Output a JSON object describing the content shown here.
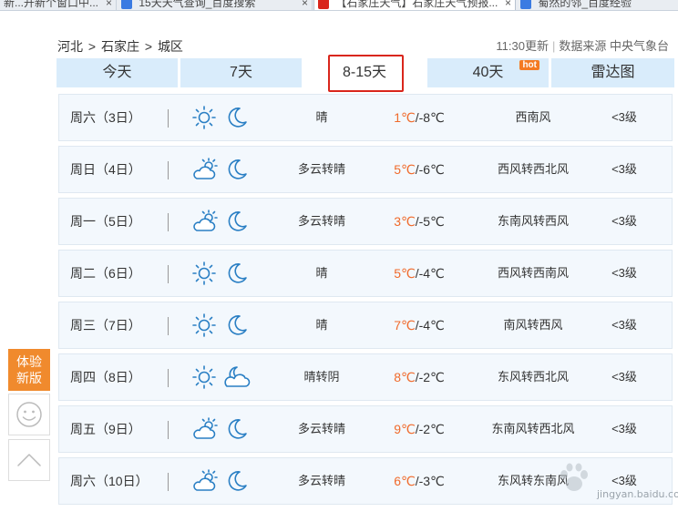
{
  "browser_tabs": [
    {
      "label": "新...开新个窗口中...",
      "favicon_color": "#4a7fd6"
    },
    {
      "label": "15天天气查询_百度搜索",
      "favicon_color": "#3b7be2"
    },
    {
      "label": "【石家庄天气】石家庄天气预报...",
      "favicon_color": "#d9261c"
    },
    {
      "label": "蜀然的邻_百度经验",
      "favicon_color": "#3b7be2"
    }
  ],
  "location": {
    "province": "河北",
    "city": "石家庄",
    "district": "城区",
    "separator": ">"
  },
  "update": {
    "time": "11:30更新",
    "source": "数据来源 中央气象台"
  },
  "period_tabs": [
    {
      "label": "今天",
      "active": false,
      "hot": false
    },
    {
      "label": "7天",
      "active": false,
      "hot": false
    },
    {
      "label": "8-15天",
      "active": true,
      "hot": false
    },
    {
      "label": "40天",
      "active": false,
      "hot": true,
      "hot_label": "hot"
    },
    {
      "label": "雷达图",
      "active": false,
      "hot": false
    }
  ],
  "forecast": [
    {
      "day": "周六（3日）",
      "icon_day": "sun-icon",
      "icon_night": "moon-icon",
      "condition": "晴",
      "high": "1℃",
      "low": "/-8℃",
      "wind": "西南风",
      "level": "<3级"
    },
    {
      "day": "周日（4日）",
      "icon_day": "partly-cloudy-icon",
      "icon_night": "moon-icon",
      "condition": "多云转晴",
      "high": "5℃",
      "low": "/-6℃",
      "wind": "西风转西北风",
      "level": "<3级"
    },
    {
      "day": "周一（5日）",
      "icon_day": "partly-cloudy-icon",
      "icon_night": "moon-icon",
      "condition": "多云转晴",
      "high": "3℃",
      "low": "/-5℃",
      "wind": "东南风转西风",
      "level": "<3级"
    },
    {
      "day": "周二（6日）",
      "icon_day": "sun-icon",
      "icon_night": "moon-icon",
      "condition": "晴",
      "high": "5℃",
      "low": "/-4℃",
      "wind": "西风转西南风",
      "level": "<3级"
    },
    {
      "day": "周三（7日）",
      "icon_day": "sun-icon",
      "icon_night": "moon-icon",
      "condition": "晴",
      "high": "7℃",
      "low": "/-4℃",
      "wind": "南风转西风",
      "level": "<3级"
    },
    {
      "day": "周四（8日）",
      "icon_day": "sun-icon",
      "icon_night": "cloudy-moon-icon",
      "condition": "晴转阴",
      "high": "8℃",
      "low": "/-2℃",
      "wind": "东风转西北风",
      "level": "<3级"
    },
    {
      "day": "周五（9日）",
      "icon_day": "partly-cloudy-icon",
      "icon_night": "moon-icon",
      "condition": "多云转晴",
      "high": "9℃",
      "low": "/-2℃",
      "wind": "东南风转西北风",
      "level": "<3级"
    },
    {
      "day": "周六（10日）",
      "icon_day": "partly-cloudy-icon",
      "icon_night": "moon-icon",
      "condition": "多云转晴",
      "high": "6℃",
      "low": "/-3℃",
      "wind": "东风转东南风",
      "level": "<3级"
    }
  ],
  "side_widgets": {
    "new_version_line1": "体验",
    "new_version_line2": "新版"
  },
  "watermark": {
    "text": "jingyan.baidu.com"
  },
  "colors": {
    "accent_blue": "#2a7fc4",
    "tab_bg": "#d9ecfb",
    "high_temp": "#f06a2b",
    "highlight_box": "#d9261c",
    "new_version": "#f08a2d"
  }
}
